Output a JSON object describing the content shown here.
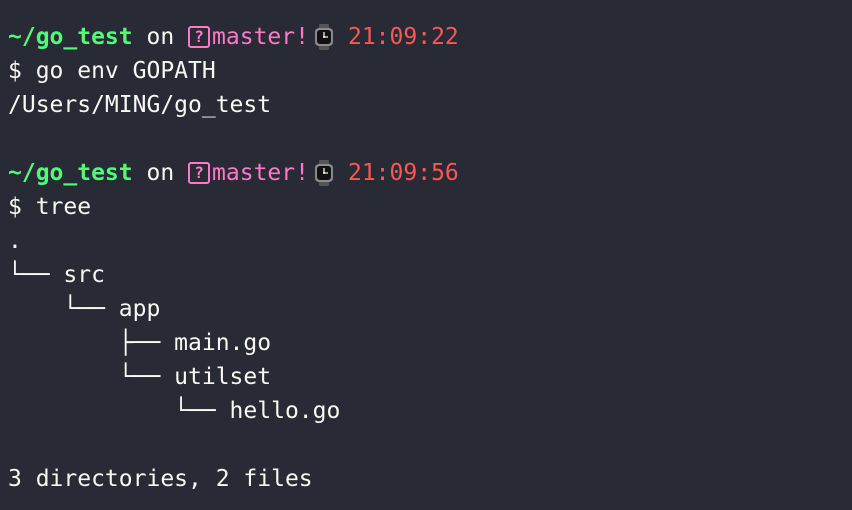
{
  "colors": {
    "background": "#282a36",
    "path": "#50fa7b",
    "branch": "#ff79c6",
    "time": "#ff5555",
    "text": "#f8f8f2"
  },
  "prompts": [
    {
      "path": "~/go_test",
      "on": "on",
      "branch_icon": "question-box-icon",
      "branch": "master!",
      "clock_icon": "watch-icon",
      "time": "21:09:22",
      "command": "$ go env GOPATH"
    },
    {
      "path": "~/go_test",
      "on": "on",
      "branch_icon": "question-box-icon",
      "branch": "master!",
      "clock_icon": "watch-icon",
      "time": "21:09:56",
      "command": "$ tree"
    }
  ],
  "gopath_output": "/Users/MING/go_test",
  "tree": {
    "root": ".",
    "lines": [
      "└── src",
      "    └── app",
      "        ├── main.go",
      "        └── utilset",
      "            └── hello.go"
    ],
    "summary": "3 directories, 2 files"
  },
  "question_mark": "?"
}
